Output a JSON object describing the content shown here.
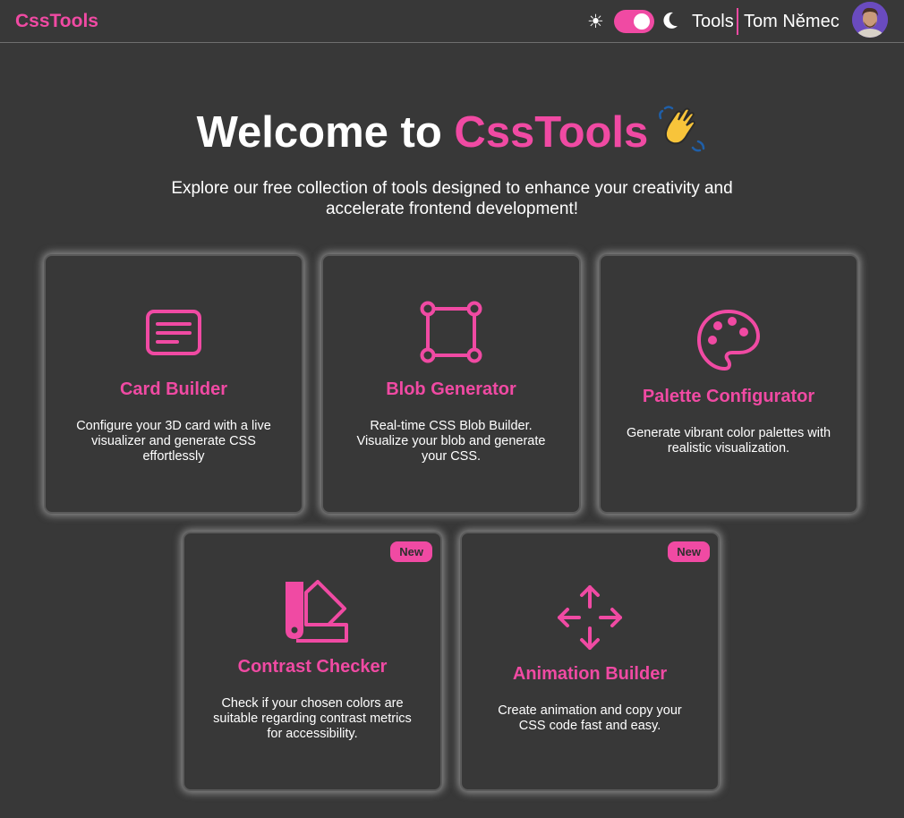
{
  "header": {
    "logo": "CssTools",
    "nav_tools": "Tools",
    "user_name": "Tom Němec",
    "sun_icon": "☀",
    "theme_toggle_on": true
  },
  "hero": {
    "title_prefix": "Welcome to ",
    "title_accent": "CssTools",
    "subtitle": "Explore our free collection of tools designed to enhance your creativity and accelerate frontend development!"
  },
  "colors": {
    "accent": "#f04aa3",
    "background": "#383838",
    "text": "#ffffff"
  },
  "cards": [
    {
      "title": "Card Builder",
      "description": "Configure your 3D card with a live visualizer and generate CSS effortlessly",
      "icon": "card-icon",
      "badge": ""
    },
    {
      "title": "Blob Generator",
      "description": "Real-time CSS Blob Builder. Visualize your blob and generate your CSS.",
      "icon": "vector-square-icon",
      "badge": ""
    },
    {
      "title": "Palette Configurator",
      "description": "Generate vibrant color palettes with realistic visualization.",
      "icon": "palette-icon",
      "badge": ""
    },
    {
      "title": "Contrast Checker",
      "description": "Check if your chosen colors are suitable regarding contrast metrics for accessibility.",
      "icon": "swatchbook-icon",
      "badge": "New"
    },
    {
      "title": "Animation Builder",
      "description": "Create animation and copy your CSS code fast and easy.",
      "icon": "move-arrows-icon",
      "badge": "New"
    }
  ]
}
